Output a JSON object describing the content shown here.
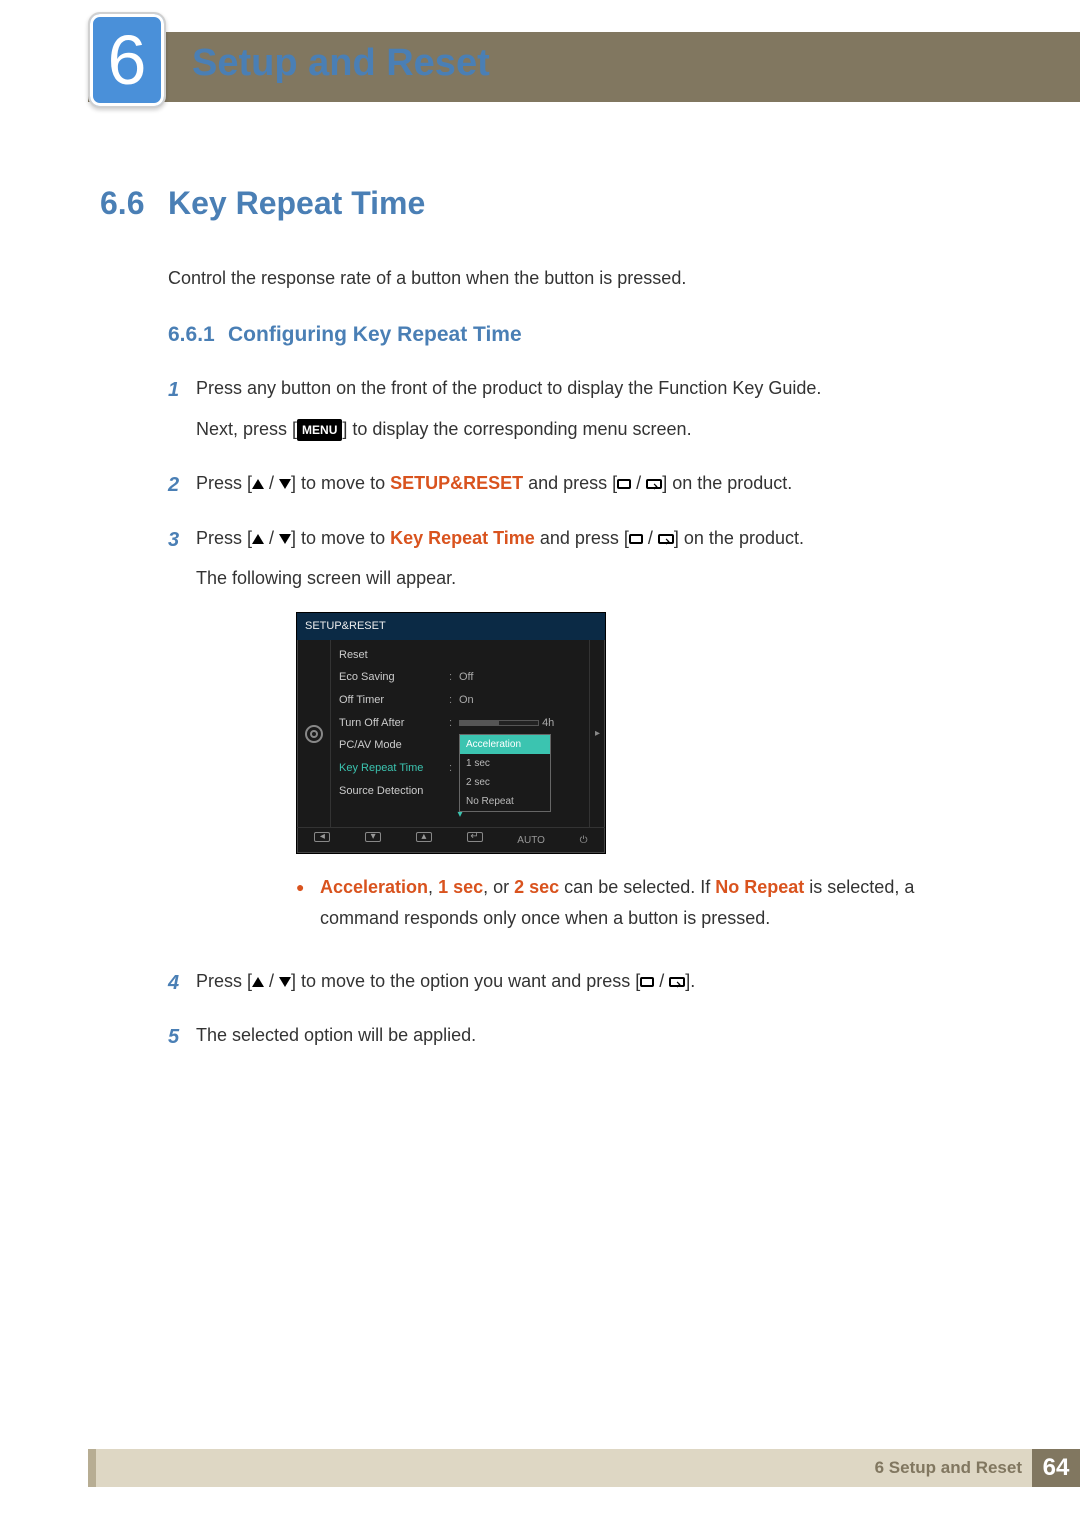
{
  "chapter": {
    "number": "6",
    "title": "Setup and Reset"
  },
  "section": {
    "number": "6.6",
    "title": "Key Repeat Time"
  },
  "intro": "Control the response rate of a button when the button is pressed.",
  "subsection": {
    "number": "6.6.1",
    "title": "Configuring Key Repeat Time"
  },
  "steps": {
    "s1": {
      "n": "1",
      "p1": "Press any button on the front of the product to display the Function Key Guide.",
      "p2a": "Next, press [",
      "menu": "MENU",
      "p2b": "] to display the corresponding menu screen."
    },
    "s2": {
      "n": "2",
      "a": "Press [",
      "b": "] to move to ",
      "target": "SETUP&RESET",
      "c": " and press [",
      "d": "] on the product."
    },
    "s3": {
      "n": "3",
      "a": "Press [",
      "b": "] to move to ",
      "target": "Key Repeat Time",
      "c": " and press [",
      "d": "] on the product.",
      "p2": "The following screen will appear."
    },
    "s4": {
      "n": "4",
      "a": "Press [",
      "b": "] to move to the option you want and press [",
      "c": "]."
    },
    "s5": {
      "n": "5",
      "text": "The selected option will be applied."
    }
  },
  "bullet": {
    "a": "Acceleration",
    "sep1": ", ",
    "b": "1 sec",
    "sep2": ", or ",
    "c": "2 sec",
    "mid": " can be selected. If ",
    "d": "No Repeat",
    "end": " is selected, a command responds only once when a button is pressed."
  },
  "osd": {
    "title": "SETUP&RESET",
    "rows": {
      "reset": "Reset",
      "eco": "Eco Saving",
      "eco_v": "Off",
      "offtimer": "Off Timer",
      "offtimer_v": "On",
      "turnoff": "Turn Off After",
      "turnoff_v": "4h",
      "pcav": "PC/AV Mode",
      "krt": "Key Repeat Time",
      "src": "Source Detection"
    },
    "dd": {
      "o1": "Acceleration",
      "o2": "1 sec",
      "o3": "2 sec",
      "o4": "No Repeat"
    },
    "bottom": {
      "auto": "AUTO"
    }
  },
  "footer": {
    "text": "6 Setup and Reset",
    "page": "64"
  }
}
